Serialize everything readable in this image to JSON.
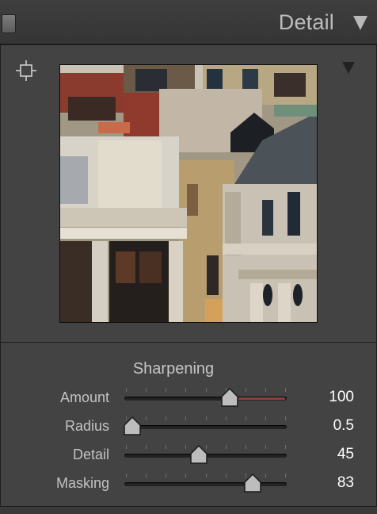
{
  "header": {
    "title": "Detail",
    "icons": [
      "solo-toggle",
      "collapse-arrow-icon"
    ]
  },
  "preview": {
    "icons": [
      "target-crosshair-icon",
      "menu-triangle-icon"
    ],
    "image_description": "zoomed detail of city buildings"
  },
  "sharpening": {
    "title": "Sharpening",
    "sliders": [
      {
        "label": "Amount",
        "value": "100",
        "fraction": 0.65,
        "accent": "#8a4141",
        "filled": true
      },
      {
        "label": "Radius",
        "value": "0.5",
        "fraction": 0.05,
        "filled": false
      },
      {
        "label": "Detail",
        "value": "45",
        "fraction": 0.46,
        "filled": false
      },
      {
        "label": "Masking",
        "value": "83",
        "fraction": 0.79,
        "filled": false
      }
    ]
  },
  "colors": {
    "panel_bg": "#434343",
    "amount_accent": "#8a4141"
  }
}
